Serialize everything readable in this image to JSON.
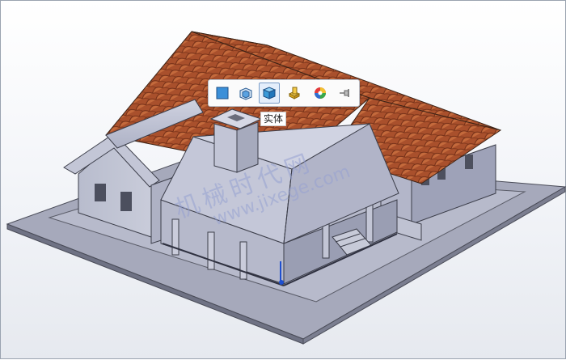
{
  "toolbar": {
    "buttons": [
      {
        "name": "face-select-button",
        "icon": "square-face-icon",
        "active": false
      },
      {
        "name": "surface-body-button",
        "icon": "surface-body-icon",
        "active": false
      },
      {
        "name": "solid-body-button",
        "icon": "solid-cube-icon",
        "active": true
      },
      {
        "name": "feature-button",
        "icon": "feature-icon",
        "active": false
      },
      {
        "name": "appearance-button",
        "icon": "color-wheel-icon",
        "active": false
      },
      {
        "name": "pin-button",
        "icon": "pin-icon",
        "active": false
      }
    ]
  },
  "tooltip": {
    "text": "实体"
  },
  "watermark": {
    "title": "机械时代网",
    "url": "www.jixege.com"
  },
  "colors": {
    "roof": "#a94a28",
    "walls": "#bfc3d4",
    "base": "#8e92a6",
    "accent": "#3b73b9"
  }
}
